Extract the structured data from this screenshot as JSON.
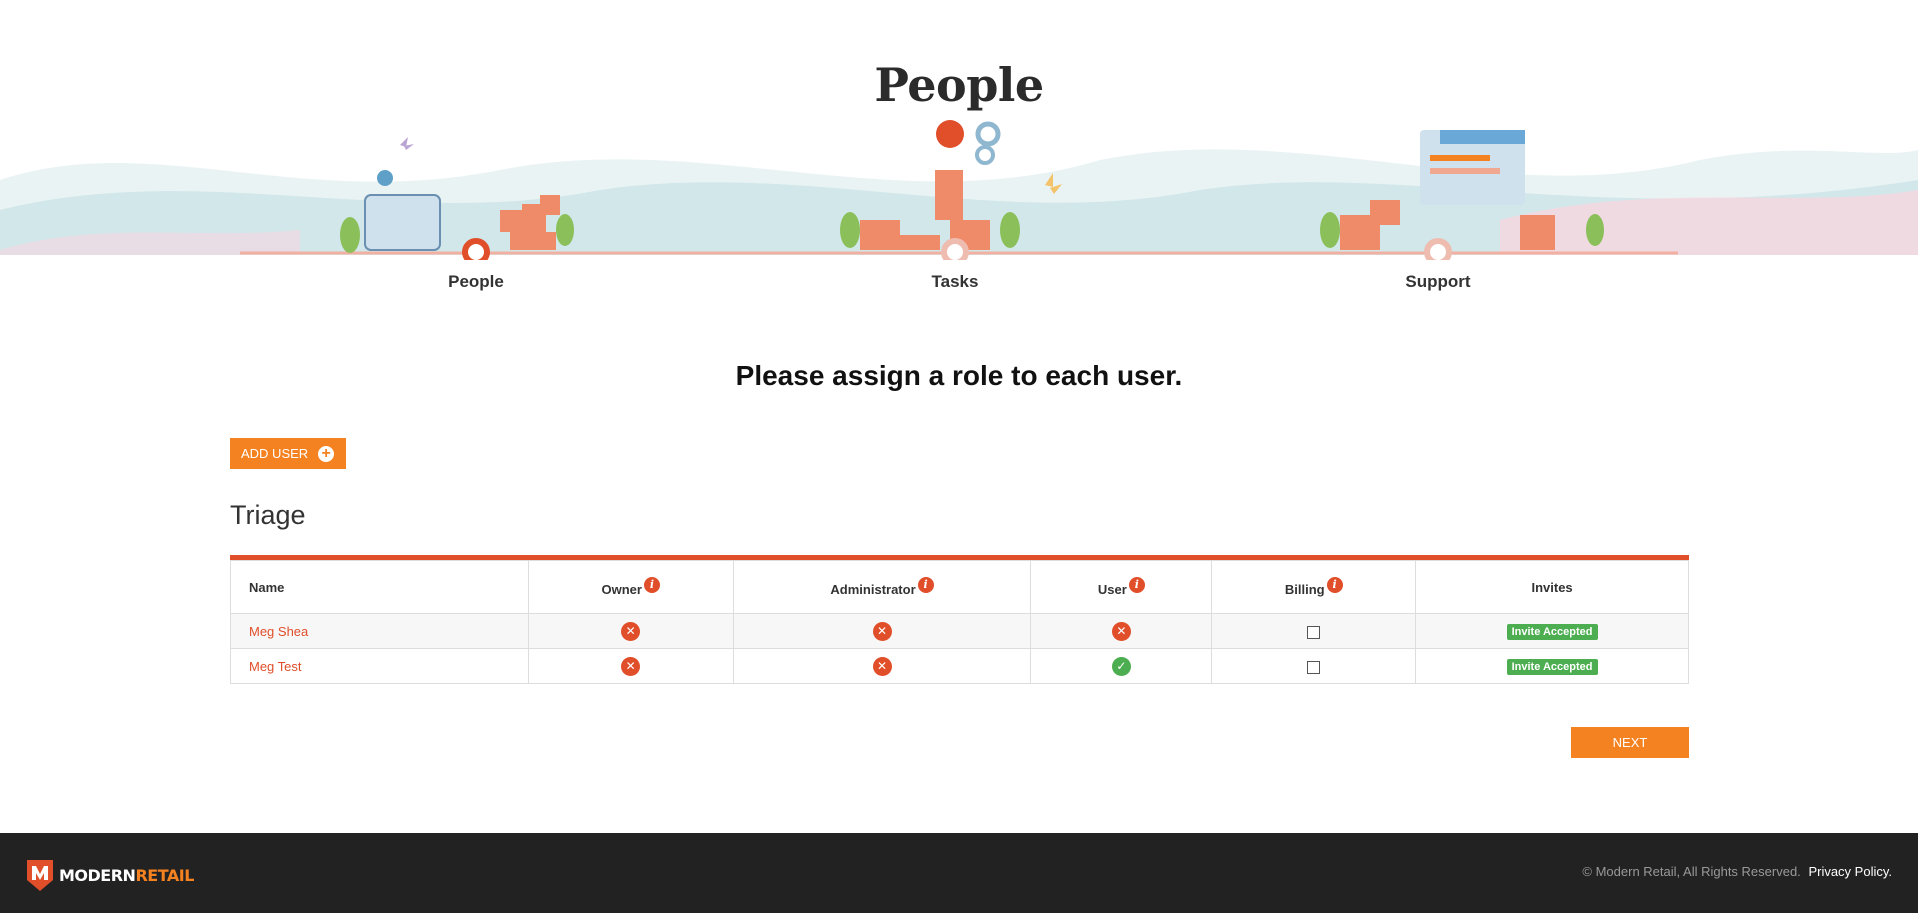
{
  "page": {
    "title": "People",
    "instruction": "Please assign a role to each user."
  },
  "steps": [
    {
      "label": "People",
      "active": true
    },
    {
      "label": "Tasks",
      "active": false
    },
    {
      "label": "Support",
      "active": false
    }
  ],
  "actions": {
    "add_user_label": "ADD USER",
    "next_label": "NEXT"
  },
  "group": {
    "title": "Triage"
  },
  "table": {
    "columns": [
      "Name",
      "Owner",
      "Administrator",
      "User",
      "Billing",
      "Invites"
    ],
    "rows": [
      {
        "name": "Meg Shea",
        "owner": "x-icon",
        "administrator": "x-icon",
        "user": "x-icon",
        "billing": "unchecked",
        "invites": "Invite Accepted"
      },
      {
        "name": "Meg Test",
        "owner": "x-icon",
        "administrator": "x-icon",
        "user": "check-icon",
        "billing": "unchecked",
        "invites": "Invite Accepted"
      }
    ]
  },
  "footer": {
    "logo_word_1": "MODERN",
    "logo_word_2": "RETAIL",
    "copyright": "© Modern Retail, All Rights Reserved.",
    "privacy_label": "Privacy Policy."
  },
  "colors": {
    "accent_orange": "#f58220",
    "accent_red": "#e04e2a",
    "success_green": "#4cae50",
    "footer_bg": "#222222"
  }
}
